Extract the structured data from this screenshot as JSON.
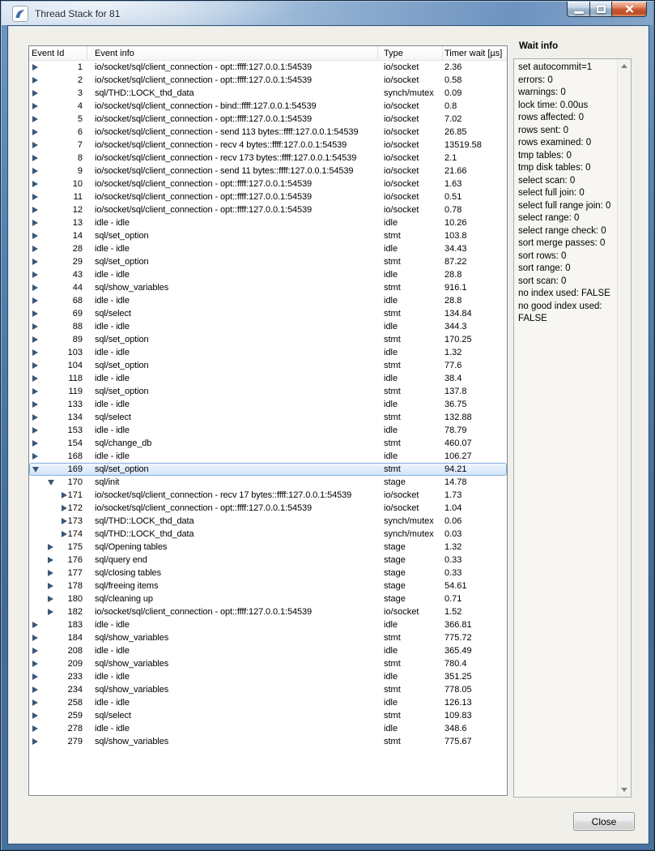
{
  "window": {
    "title": "Thread Stack for 81",
    "icon": "mysql-workbench-icon",
    "controls": [
      "minimize",
      "maximize",
      "close"
    ]
  },
  "table": {
    "columns": [
      "Event Id",
      "Event info",
      "Type",
      "Timer wait [µs]"
    ],
    "rows": [
      {
        "id": "1",
        "info": "io/socket/sql/client_connection - opt::ffff:127.0.0.1:54539",
        "type": "io/socket",
        "wait": "2.36",
        "depth": 0
      },
      {
        "id": "2",
        "info": "io/socket/sql/client_connection - opt::ffff:127.0.0.1:54539",
        "type": "io/socket",
        "wait": "0.58",
        "depth": 0
      },
      {
        "id": "3",
        "info": "sql/THD::LOCK_thd_data",
        "type": "synch/mutex",
        "wait": "0.09",
        "depth": 0
      },
      {
        "id": "4",
        "info": "io/socket/sql/client_connection - bind::ffff:127.0.0.1:54539",
        "type": "io/socket",
        "wait": "0.8",
        "depth": 0
      },
      {
        "id": "5",
        "info": "io/socket/sql/client_connection - opt::ffff:127.0.0.1:54539",
        "type": "io/socket",
        "wait": "7.02",
        "depth": 0
      },
      {
        "id": "6",
        "info": "io/socket/sql/client_connection - send 113 bytes::ffff:127.0.0.1:54539",
        "type": "io/socket",
        "wait": "26.85",
        "depth": 0
      },
      {
        "id": "7",
        "info": "io/socket/sql/client_connection - recv 4 bytes::ffff:127.0.0.1:54539",
        "type": "io/socket",
        "wait": "13519.58",
        "depth": 0
      },
      {
        "id": "8",
        "info": "io/socket/sql/client_connection - recv 173 bytes::ffff:127.0.0.1:54539",
        "type": "io/socket",
        "wait": "2.1",
        "depth": 0
      },
      {
        "id": "9",
        "info": "io/socket/sql/client_connection - send 11 bytes::ffff:127.0.0.1:54539",
        "type": "io/socket",
        "wait": "21.66",
        "depth": 0
      },
      {
        "id": "10",
        "info": "io/socket/sql/client_connection - opt::ffff:127.0.0.1:54539",
        "type": "io/socket",
        "wait": "1.63",
        "depth": 0
      },
      {
        "id": "11",
        "info": "io/socket/sql/client_connection - opt::ffff:127.0.0.1:54539",
        "type": "io/socket",
        "wait": "0.51",
        "depth": 0
      },
      {
        "id": "12",
        "info": "io/socket/sql/client_connection - opt::ffff:127.0.0.1:54539",
        "type": "io/socket",
        "wait": "0.78",
        "depth": 0
      },
      {
        "id": "13",
        "info": "idle - idle",
        "type": "idle",
        "wait": "10.26",
        "depth": 0
      },
      {
        "id": "14",
        "info": "sql/set_option",
        "type": "stmt",
        "wait": "103.8",
        "depth": 0
      },
      {
        "id": "28",
        "info": "idle - idle",
        "type": "idle",
        "wait": "34.43",
        "depth": 0
      },
      {
        "id": "29",
        "info": "sql/set_option",
        "type": "stmt",
        "wait": "87.22",
        "depth": 0
      },
      {
        "id": "43",
        "info": "idle - idle",
        "type": "idle",
        "wait": "28.8",
        "depth": 0
      },
      {
        "id": "44",
        "info": "sql/show_variables",
        "type": "stmt",
        "wait": "916.1",
        "depth": 0
      },
      {
        "id": "68",
        "info": "idle - idle",
        "type": "idle",
        "wait": "28.8",
        "depth": 0
      },
      {
        "id": "69",
        "info": "sql/select",
        "type": "stmt",
        "wait": "134.84",
        "depth": 0
      },
      {
        "id": "88",
        "info": "idle - idle",
        "type": "idle",
        "wait": "344.3",
        "depth": 0
      },
      {
        "id": "89",
        "info": "sql/set_option",
        "type": "stmt",
        "wait": "170.25",
        "depth": 0
      },
      {
        "id": "103",
        "info": "idle - idle",
        "type": "idle",
        "wait": "1.32",
        "depth": 0
      },
      {
        "id": "104",
        "info": "sql/set_option",
        "type": "stmt",
        "wait": "77.6",
        "depth": 0
      },
      {
        "id": "118",
        "info": "idle - idle",
        "type": "idle",
        "wait": "38.4",
        "depth": 0
      },
      {
        "id": "119",
        "info": "sql/set_option",
        "type": "stmt",
        "wait": "137.8",
        "depth": 0
      },
      {
        "id": "133",
        "info": "idle - idle",
        "type": "idle",
        "wait": "36.75",
        "depth": 0
      },
      {
        "id": "134",
        "info": "sql/select",
        "type": "stmt",
        "wait": "132.88",
        "depth": 0
      },
      {
        "id": "153",
        "info": "idle - idle",
        "type": "idle",
        "wait": "78.79",
        "depth": 0
      },
      {
        "id": "154",
        "info": "sql/change_db",
        "type": "stmt",
        "wait": "460.07",
        "depth": 0
      },
      {
        "id": "168",
        "info": "idle - idle",
        "type": "idle",
        "wait": "106.27",
        "depth": 0
      },
      {
        "id": "169",
        "info": "sql/set_option",
        "type": "stmt",
        "wait": "94.21",
        "depth": 0,
        "expanded": true,
        "selected": true
      },
      {
        "id": "170",
        "info": "sql/init",
        "type": "stage",
        "wait": "14.78",
        "depth": 1,
        "expanded": true
      },
      {
        "id": "171",
        "info": "io/socket/sql/client_connection - recv 17 bytes::ffff:127.0.0.1:54539",
        "type": "io/socket",
        "wait": "1.73",
        "depth": 2
      },
      {
        "id": "172",
        "info": "io/socket/sql/client_connection - opt::ffff:127.0.0.1:54539",
        "type": "io/socket",
        "wait": "1.04",
        "depth": 2
      },
      {
        "id": "173",
        "info": "sql/THD::LOCK_thd_data",
        "type": "synch/mutex",
        "wait": "0.06",
        "depth": 2
      },
      {
        "id": "174",
        "info": "sql/THD::LOCK_thd_data",
        "type": "synch/mutex",
        "wait": "0.03",
        "depth": 2
      },
      {
        "id": "175",
        "info": "sql/Opening tables",
        "type": "stage",
        "wait": "1.32",
        "depth": 1
      },
      {
        "id": "176",
        "info": "sql/query end",
        "type": "stage",
        "wait": "0.33",
        "depth": 1
      },
      {
        "id": "177",
        "info": "sql/closing tables",
        "type": "stage",
        "wait": "0.33",
        "depth": 1
      },
      {
        "id": "178",
        "info": "sql/freeing items",
        "type": "stage",
        "wait": "54.61",
        "depth": 1
      },
      {
        "id": "180",
        "info": "sql/cleaning up",
        "type": "stage",
        "wait": "0.71",
        "depth": 1
      },
      {
        "id": "182",
        "info": "io/socket/sql/client_connection - opt::ffff:127.0.0.1:54539",
        "type": "io/socket",
        "wait": "1.52",
        "depth": 1
      },
      {
        "id": "183",
        "info": "idle - idle",
        "type": "idle",
        "wait": "366.81",
        "depth": 0
      },
      {
        "id": "184",
        "info": "sql/show_variables",
        "type": "stmt",
        "wait": "775.72",
        "depth": 0
      },
      {
        "id": "208",
        "info": "idle - idle",
        "type": "idle",
        "wait": "365.49",
        "depth": 0
      },
      {
        "id": "209",
        "info": "sql/show_variables",
        "type": "stmt",
        "wait": "780.4",
        "depth": 0
      },
      {
        "id": "233",
        "info": "idle - idle",
        "type": "idle",
        "wait": "351.25",
        "depth": 0
      },
      {
        "id": "234",
        "info": "sql/show_variables",
        "type": "stmt",
        "wait": "778.05",
        "depth": 0
      },
      {
        "id": "258",
        "info": "idle - idle",
        "type": "idle",
        "wait": "126.13",
        "depth": 0
      },
      {
        "id": "259",
        "info": "sql/select",
        "type": "stmt",
        "wait": "109.83",
        "depth": 0
      },
      {
        "id": "278",
        "info": "idle - idle",
        "type": "idle",
        "wait": "348.6",
        "depth": 0
      },
      {
        "id": "279",
        "info": "sql/show_variables",
        "type": "stmt",
        "wait": "775.67",
        "depth": 0
      }
    ]
  },
  "wait_info": {
    "title": "Wait info",
    "lines": [
      "set autocommit=1",
      "errors: 0",
      "warnings: 0",
      "lock time: 0.00us",
      "rows affected: 0",
      "rows sent: 0",
      "rows examined: 0",
      "tmp tables: 0",
      "tmp disk tables: 0",
      "select scan: 0",
      "select full join: 0",
      "select full range join: 0",
      "select range: 0",
      "select range check: 0",
      "sort merge passes: 0",
      "sort rows: 0",
      "sort range: 0",
      "sort scan: 0",
      "no index used: FALSE",
      "no good index used: FALSE"
    ]
  },
  "close_button": "Close",
  "colors": {
    "selection_border": "#84aede",
    "selection_fill": "#cfe4f7",
    "tree_arrow": "#3a5775",
    "titlebar_blue": "#8aabcf",
    "close_button_red": "#cb5a35",
    "dialog_face": "#f0efea"
  }
}
